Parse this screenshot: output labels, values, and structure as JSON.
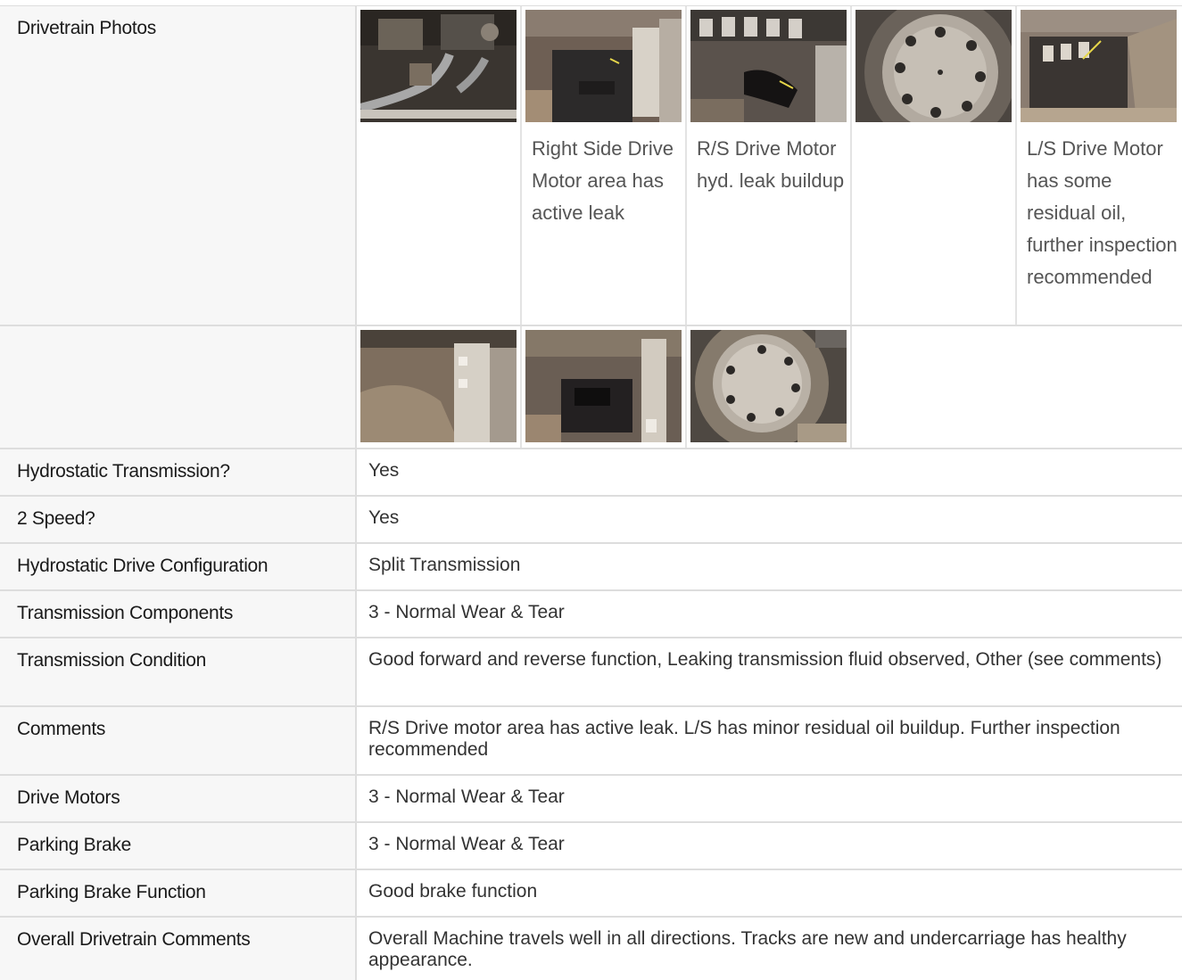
{
  "drivetrain_photos": {
    "label": "Drivetrain Photos",
    "photos_row1": [
      {
        "image": "engine-bay-hoses-photo",
        "caption": ""
      },
      {
        "image": "right-drive-motor-photo",
        "caption": "Right Side Drive Motor area has active leak"
      },
      {
        "image": "rs-drive-motor-leak-photo",
        "caption": "R/S Drive Motor hyd. leak buildup"
      },
      {
        "image": "final-drive-hub-photo",
        "caption": ""
      },
      {
        "image": "ls-drive-motor-photo",
        "caption": "L/S Drive Motor has some residual oil, further inspection recommended"
      }
    ],
    "photos_row2": [
      {
        "image": "undercarriage-dirt-photo",
        "caption": ""
      },
      {
        "image": "drive-motor-housing-photo",
        "caption": ""
      },
      {
        "image": "sprocket-hub-photo",
        "caption": ""
      }
    ]
  },
  "rows": [
    {
      "label": "Hydrostatic Transmission?",
      "value": "Yes"
    },
    {
      "label": "2 Speed?",
      "value": "Yes"
    },
    {
      "label": "Hydrostatic Drive Configuration",
      "value": "Split Transmission"
    },
    {
      "label": "Transmission Components",
      "value": "3 - Normal Wear & Tear"
    },
    {
      "label": "Transmission Condition",
      "value": "Good forward and reverse function, Leaking transmission fluid observed, Other (see comments)"
    },
    {
      "label": "Comments",
      "value": "R/S Drive motor area has active leak. L/S has minor residual oil buildup. Further inspection recommended"
    },
    {
      "label": "Drive Motors",
      "value": "3 - Normal Wear & Tear"
    },
    {
      "label": "Parking Brake",
      "value": "3 - Normal Wear & Tear"
    },
    {
      "label": "Parking Brake Function",
      "value": "Good brake function"
    },
    {
      "label": "Overall Drivetrain Comments",
      "value": "Overall Machine travels well in all directions. Tracks are new and undercarriage has healthy appearance."
    }
  ]
}
